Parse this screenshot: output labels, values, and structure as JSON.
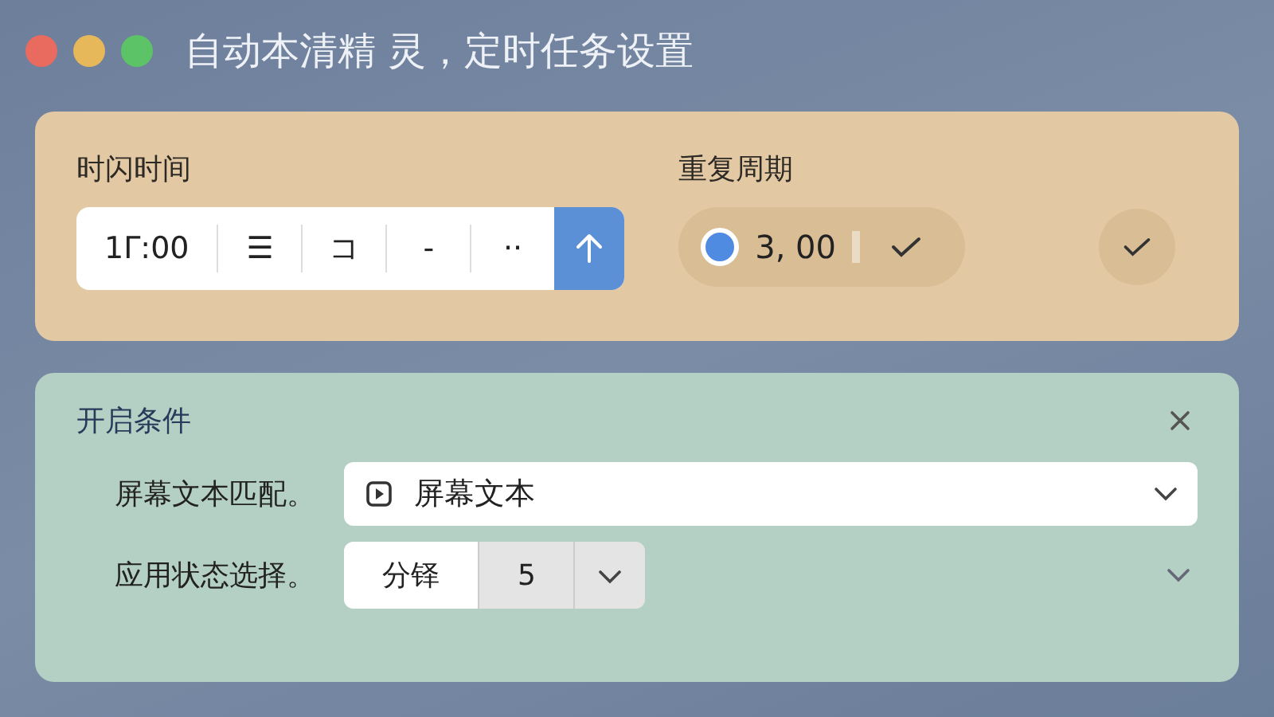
{
  "window": {
    "title": "自动本清精 灵，定时任务设置",
    "controls": [
      {
        "color": "#e96a5f"
      },
      {
        "color": "#e7b85a"
      },
      {
        "color": "#5cc466"
      }
    ]
  },
  "schedule": {
    "time": {
      "label": "时闪时间",
      "value": "1Γ:00",
      "segments": [
        "☰",
        "コ",
        "-",
        "··"
      ]
    },
    "repeat": {
      "label": "重复周期",
      "value": "3, 00",
      "radio_selected": true
    }
  },
  "conditions": {
    "title": "开启条件",
    "rows": [
      {
        "kind": "select",
        "label": "屏幕文本匹配。",
        "value": "屏幕文本"
      },
      {
        "kind": "segmented",
        "label": "应用状态选择。",
        "options": [
          {
            "label": "分铎",
            "selected": true
          },
          {
            "label": "5",
            "selected": false
          }
        ]
      }
    ]
  }
}
